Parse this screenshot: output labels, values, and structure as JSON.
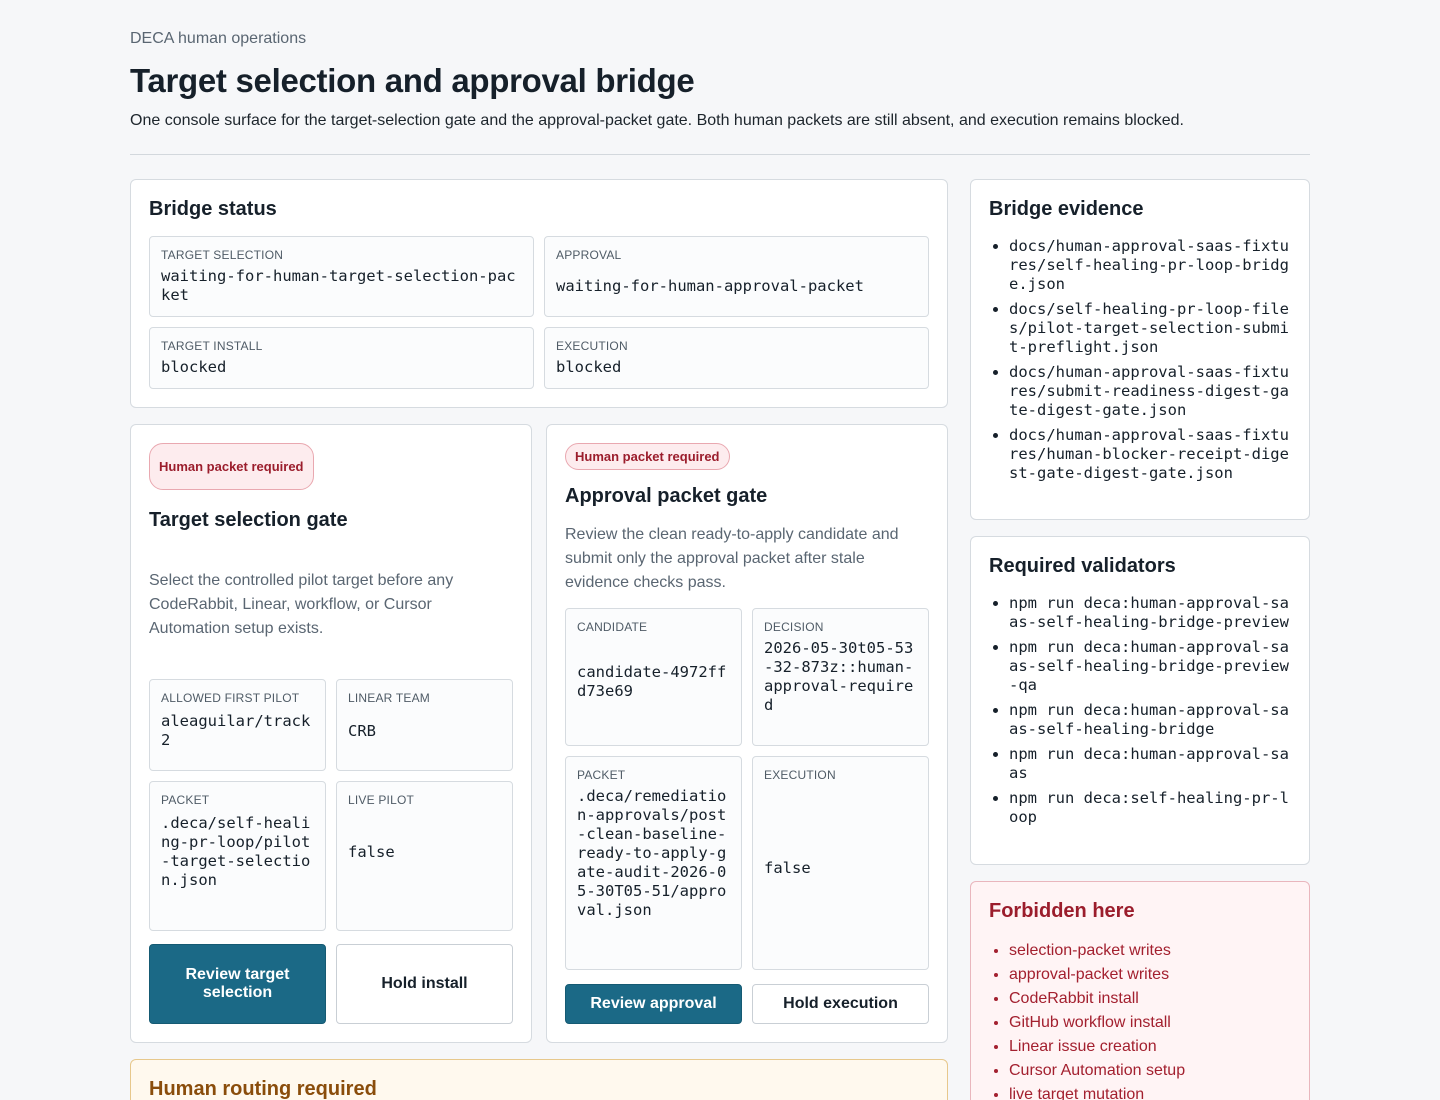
{
  "header": {
    "eyebrow": "DECA human operations",
    "title": "Target selection and approval bridge",
    "subtitle": "One console surface for the target-selection gate and the approval-packet gate. Both human packets are still absent, and execution remains blocked."
  },
  "bridge_status": {
    "title": "Bridge status",
    "fields": [
      {
        "label": "TARGET SELECTION",
        "value": "waiting-for-human-target-selection-packet"
      },
      {
        "label": "APPROVAL",
        "value": "waiting-for-human-approval-packet"
      },
      {
        "label": "TARGET INSTALL",
        "value": "blocked"
      },
      {
        "label": "EXECUTION",
        "value": "blocked"
      }
    ]
  },
  "target_gate": {
    "badge": "Human packet required",
    "title": "Target selection gate",
    "description": "Select the controlled pilot target before any CodeRabbit, Linear, workflow, or Cursor Automation setup exists.",
    "fields": [
      {
        "label": "ALLOWED FIRST PILOT",
        "value": "aleaguilar/track2"
      },
      {
        "label": "LINEAR TEAM",
        "value": "CRB"
      },
      {
        "label": "PACKET",
        "value": ".deca/self-healing-pr-loop/pilot-target-selection.json"
      },
      {
        "label": "LIVE PILOT",
        "value": "false"
      }
    ],
    "primary_button": "Review target selection",
    "secondary_button": "Hold install"
  },
  "approval_gate": {
    "badge": "Human packet required",
    "title": "Approval packet gate",
    "description": "Review the clean ready-to-apply candidate and submit only the approval packet after stale evidence checks pass.",
    "fields": [
      {
        "label": "CANDIDATE",
        "value": "candidate-4972ffd73e69"
      },
      {
        "label": "DECISION",
        "value": "2026-05-30t05-53-32-873z::human-approval-required"
      },
      {
        "label": "PACKET",
        "value": ".deca/remediation-approvals/post-clean-baseline-ready-to-apply-gate-audit-2026-05-30T05-51/approval.json"
      },
      {
        "label": "EXECUTION",
        "value": "false"
      }
    ],
    "primary_button": "Review approval",
    "secondary_button": "Hold execution"
  },
  "routing": {
    "title": "Human routing required"
  },
  "evidence": {
    "title": "Bridge evidence",
    "items": [
      "docs/human-approval-saas-fixtures/self-healing-pr-loop-bridge.json",
      "docs/self-healing-pr-loop-files/pilot-target-selection-submit-preflight.json",
      "docs/human-approval-saas-fixtures/submit-readiness-digest-gate-digest-gate.json",
      "docs/human-approval-saas-fixtures/human-blocker-receipt-digest-gate-digest-gate.json"
    ]
  },
  "validators": {
    "title": "Required validators",
    "items": [
      "npm run deca:human-approval-saas-self-healing-bridge-preview",
      "npm run deca:human-approval-saas-self-healing-bridge-preview-qa",
      "npm run deca:human-approval-saas-self-healing-bridge",
      "npm run deca:human-approval-saas",
      "npm run deca:self-healing-pr-loop"
    ]
  },
  "forbidden": {
    "title": "Forbidden here",
    "items": [
      "selection-packet writes",
      "approval-packet writes",
      "CodeRabbit install",
      "GitHub workflow install",
      "Linear issue creation",
      "Cursor Automation setup",
      "live target mutation"
    ]
  }
}
